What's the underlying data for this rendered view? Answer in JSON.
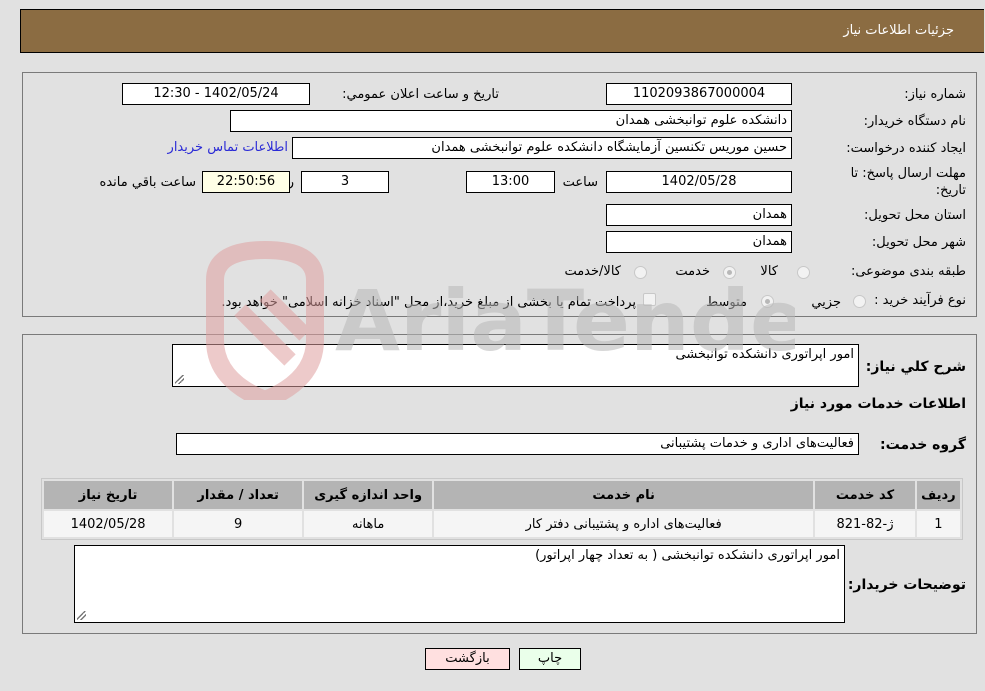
{
  "header": {
    "title": "جزئیات اطلاعات نیاز"
  },
  "details": {
    "need_number_label": "شماره نیاز:",
    "need_number": "1102093867000004",
    "announce_label": "تاریخ و ساعت اعلان عمومي:",
    "announce_value": "1402/05/24 - 12:30",
    "buyer_org_label": "نام دستگاه خريدار:",
    "buyer_org": "دانشکده علوم توانبخشی همدان",
    "creator_label": "ایجاد کننده درخواست:",
    "creator": "حسین موریس تکنسین آزمایشگاه دانشکده علوم توانبخشی همدان",
    "contact_link": "اطلاعات تماس خریدار",
    "deadline_label_line1": "مهلت ارسال پاسخ: تا",
    "deadline_label_line2": "تاریخ:",
    "deadline_date": "1402/05/28",
    "time_label": "ساعت",
    "deadline_time": "13:00",
    "days_value": "3",
    "days_label": "روز و",
    "remaining_time": "22:50:56",
    "remaining_label": "ساعت باقي مانده",
    "province_label": "استان محل تحویل:",
    "province": "همدان",
    "city_label": "شهر محل تحویل:",
    "city": "همدان",
    "category_label": "طبقه بندی موضوعی:",
    "category_options": [
      {
        "label": "کالا",
        "checked": false
      },
      {
        "label": "خدمت",
        "checked": true
      },
      {
        "label": "کالا/خدمت",
        "checked": false
      }
    ],
    "process_label": "نوع فرآیند خرید :",
    "process_options": [
      {
        "label": "جزيي",
        "checked": false
      },
      {
        "label": "متوسط",
        "checked": true
      }
    ],
    "treasury_note": "پرداخت تمام یا بخشی از مبلغ خرید،از محل \"اسناد خزانه اسلامی\" خواهد بود."
  },
  "services": {
    "summary_label": "شرح کلي نياز:",
    "summary": "امور اپراتوری دانشکده توانبخشی",
    "section_title": "اطلاعات خدمات مورد نیاز",
    "group_label": "گروه خدمت:",
    "group": "فعالیت‌های اداری و خدمات پشتیبانی",
    "table": {
      "headers": [
        "ردیف",
        "کد خدمت",
        "نام خدمت",
        "واحد اندازه گیری",
        "تعداد / مقدار",
        "تاریخ نیاز"
      ],
      "rows": [
        [
          "1",
          "ژ-82-821",
          "فعالیت‌های اداره و پشتیبانی دفتر کار",
          "ماهانه",
          "9",
          "1402/05/28"
        ]
      ]
    },
    "buyer_notes_label": "توضیحات خریدار:",
    "buyer_notes": "امور اپراتوری دانشکده توانبخشی ( به تعداد چهار اپراتور)"
  },
  "buttons": {
    "back": "بازگشت",
    "print": "چاپ"
  },
  "watermark": {
    "text": "AriaTender.neT"
  }
}
